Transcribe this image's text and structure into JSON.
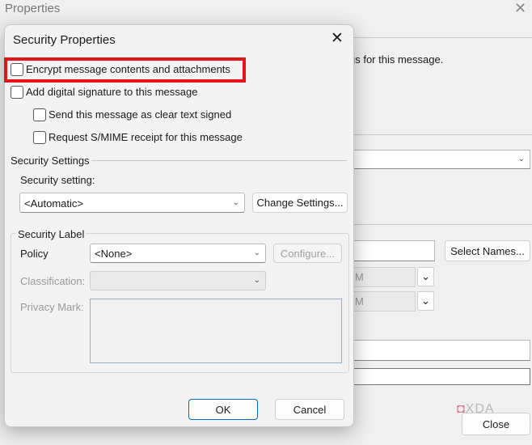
{
  "background_window": {
    "title": "Properties",
    "description_fragment": "gs for this message.",
    "select_names_label": "Select Names...",
    "disabled_value_1": "M",
    "disabled_value_2": "M",
    "close_label": "Close",
    "watermark": "XDA"
  },
  "dialog": {
    "title": "Security Properties",
    "checkboxes": [
      {
        "label": "Encrypt message contents and attachments",
        "checked": false,
        "highlighted": true
      },
      {
        "label": "Add digital signature to this message",
        "checked": false
      },
      {
        "label": "Send this message as clear text signed",
        "checked": false
      },
      {
        "label": "Request S/MIME receipt for this message",
        "checked": false
      }
    ],
    "security_settings": {
      "group_label": "Security Settings",
      "setting_label": "Security setting:",
      "setting_value": "<Automatic>",
      "change_button": "Change Settings..."
    },
    "security_label": {
      "group_label": "Security Label",
      "policy_label": "Policy",
      "policy_value": "<None>",
      "configure_button": "Configure...",
      "classification_label": "Classification:",
      "privacy_mark_label": "Privacy Mark:"
    },
    "ok_label": "OK",
    "cancel_label": "Cancel"
  },
  "colors": {
    "highlight": "#e3141b",
    "accent": "#0067c0"
  }
}
